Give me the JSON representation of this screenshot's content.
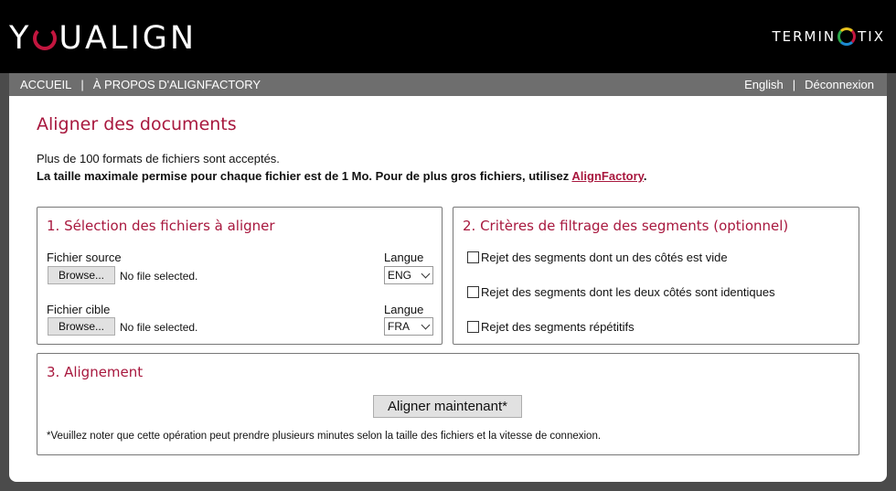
{
  "header": {
    "logo_left": {
      "before": "Y",
      "after": "UALIGN"
    },
    "logo_right": {
      "before": "TERMIN",
      "after": "TIX"
    }
  },
  "nav": {
    "left": [
      "ACCUEIL",
      "À PROPOS D'ALIGNFACTORY"
    ],
    "right": [
      "English",
      "Déconnexion"
    ],
    "separator": "|"
  },
  "main": {
    "title": "Aligner des documents",
    "intro_line1": "Plus de 100 formats de fichiers sont acceptés.",
    "intro_line2": "La taille maximale permise pour chaque fichier est de 1 Mo. Pour de plus gros fichiers, utilisez ",
    "intro_link": "AlignFactory",
    "intro_end": "."
  },
  "section1": {
    "title": "1. Sélection des fichiers à aligner",
    "source": {
      "label": "Fichier source",
      "button": "Browse...",
      "status": "No file selected.",
      "lang_label": "Langue",
      "lang_value": "ENG"
    },
    "target": {
      "label": "Fichier cible",
      "button": "Browse...",
      "status": "No file selected.",
      "lang_label": "Langue",
      "lang_value": "FRA"
    }
  },
  "section2": {
    "title": "2. Critères de filtrage des segments (optionnel)",
    "options": [
      {
        "label": "Rejet des segments dont un des côtés est vide",
        "checked": false
      },
      {
        "label": "Rejet des segments dont les deux côtés sont identiques",
        "checked": false
      },
      {
        "label": "Rejet des segments répétitifs",
        "checked": false
      }
    ]
  },
  "section3": {
    "title": "3. Alignement",
    "button": "Aligner maintenant*",
    "note": "*Veuillez noter que cette opération peut prendre plusieurs minutes selon la taille des fichiers et la vitesse de connexion."
  },
  "colors": {
    "accent": "#a8183e",
    "header_bg": "#000000",
    "nav_bg": "#6e6e6e",
    "page_bg": "#4b4b4b"
  }
}
